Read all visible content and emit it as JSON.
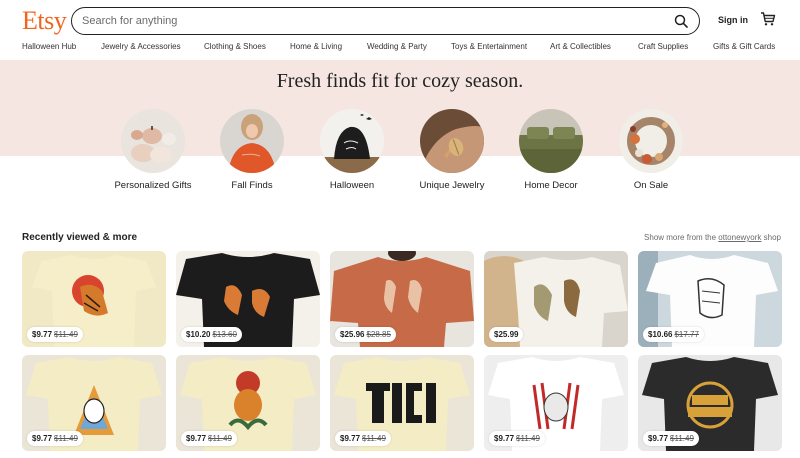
{
  "header": {
    "logo": "Etsy",
    "search_placeholder": "Search for anything",
    "sign_in": "Sign in"
  },
  "categories": [
    "Halloween Hub",
    "Jewelry & Accessories",
    "Clothing & Shoes",
    "Home & Living",
    "Wedding & Party",
    "Toys & Entertainment",
    "Art & Collectibles",
    "Craft Supplies",
    "Gifts & Gift Cards"
  ],
  "hero": {
    "title": "Fresh finds fit for cozy season.",
    "circles": [
      {
        "label": "Personalized Gifts"
      },
      {
        "label": "Fall Finds"
      },
      {
        "label": "Halloween"
      },
      {
        "label": "Unique Jewelry"
      },
      {
        "label": "Home Decor"
      },
      {
        "label": "On Sale"
      }
    ]
  },
  "recent": {
    "title": "Recently viewed & more",
    "show_more_prefix": "Show more from the ",
    "shop_name": "ottonewyork",
    "show_more_suffix": " shop",
    "items": [
      {
        "price": "$9.77",
        "original": "$11.49"
      },
      {
        "price": "$10.20",
        "original": "$13.60"
      },
      {
        "price": "$25.96",
        "original": "$28.85"
      },
      {
        "price": "$25.99",
        "original": ""
      },
      {
        "price": "$10.66",
        "original": "$17.77"
      },
      {
        "price": "$9.77",
        "original": "$11.49"
      },
      {
        "price": "$9.77",
        "original": "$11.49"
      },
      {
        "price": "$9.77",
        "original": "$11.49"
      },
      {
        "price": "$9.77",
        "original": "$11.49"
      },
      {
        "price": "$9.77",
        "original": "$11.49"
      }
    ]
  },
  "colors": {
    "brand": "#f1641e",
    "hero_bg": "#f6e6e1"
  }
}
